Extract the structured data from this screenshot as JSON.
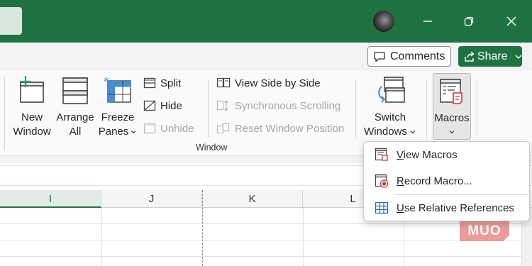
{
  "title_bar": {
    "background_color": "#1f7343",
    "window_controls": [
      "minimize-icon",
      "restore-icon",
      "close-icon"
    ]
  },
  "actions": {
    "comments_label": "Comments",
    "share_label": "Share"
  },
  "ribbon": {
    "group_label": "Window",
    "new_window": [
      "New",
      "Window"
    ],
    "arrange_all": [
      "Arrange",
      "All"
    ],
    "freeze_panes": [
      "Freeze",
      "Panes"
    ],
    "split_label": "Split",
    "hide_label": "Hide",
    "unhide_label": "Unhide",
    "view_side_by_side_label": "View Side by Side",
    "synchronous_scrolling_label": "Synchronous Scrolling",
    "reset_window_position_label": "Reset Window Position",
    "switch_windows": [
      "Switch",
      "Windows"
    ],
    "macros_label": "Macros"
  },
  "macros_menu": {
    "view_macros": {
      "accel": "V",
      "rest": "iew Macros"
    },
    "record_macro": {
      "accel": "R",
      "rest": "ecord Macro..."
    },
    "use_relative_references": {
      "accel": "U",
      "rest": "se Relative References"
    }
  },
  "sheet": {
    "column_headers": [
      "I",
      "J",
      "K",
      "L"
    ],
    "selected_column": "I"
  },
  "watermark": "MUO"
}
